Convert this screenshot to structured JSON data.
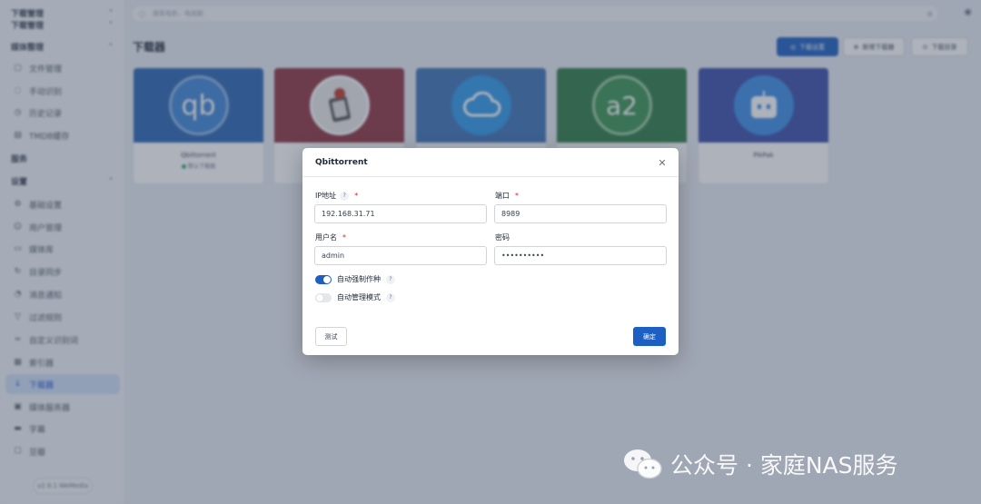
{
  "sidebar": {
    "items": [
      {
        "label": "下载管理",
        "type": "group",
        "icon": "",
        "chevron": "chevron-down-icon"
      },
      {
        "label": "下载管理",
        "type": "group",
        "icon": "",
        "chevron": "chevron-down-icon"
      },
      {
        "label": "媒体整理",
        "type": "group",
        "icon": "",
        "chevron": "chevron-up-icon"
      },
      {
        "label": "文件管理",
        "type": "sub",
        "icon": "folder-icon"
      },
      {
        "label": "手动识别",
        "type": "sub",
        "icon": "search-icon"
      },
      {
        "label": "历史记录",
        "type": "sub",
        "icon": "history-icon"
      },
      {
        "label": "TMDB缓存",
        "type": "sub",
        "icon": "database-icon"
      },
      {
        "label": "服务",
        "type": "group",
        "icon": ""
      },
      {
        "label": "设置",
        "type": "group",
        "icon": "",
        "chevron": "chevron-up-icon"
      },
      {
        "label": "基础设置",
        "type": "sub",
        "icon": "gear-icon"
      },
      {
        "label": "用户管理",
        "type": "sub",
        "icon": "user-icon"
      },
      {
        "label": "媒体库",
        "type": "sub",
        "icon": "library-icon"
      },
      {
        "label": "目录同步",
        "type": "sub",
        "icon": "sync-icon"
      },
      {
        "label": "消息通知",
        "type": "sub",
        "icon": "bell-icon"
      },
      {
        "label": "过滤规则",
        "type": "sub",
        "icon": "filter-icon"
      },
      {
        "label": "自定义识别词",
        "type": "sub",
        "icon": "words-icon"
      },
      {
        "label": "索引器",
        "type": "sub",
        "icon": "indexer-icon"
      },
      {
        "label": "下载器",
        "type": "sub",
        "icon": "download-icon",
        "active": true
      },
      {
        "label": "媒体服务器",
        "type": "sub",
        "icon": "server-icon"
      },
      {
        "label": "字幕",
        "type": "sub",
        "icon": "subtitle-icon"
      },
      {
        "label": "豆瓣",
        "type": "sub",
        "icon": "douban-icon"
      }
    ],
    "version": "v2.9.1 WeMedia"
  },
  "topbar": {
    "search_placeholder": "搜索电影、电视剧"
  },
  "page": {
    "title": "下载器",
    "buttons": [
      "下载设置",
      "新增下载器",
      "下载目录"
    ]
  },
  "cards": [
    {
      "name": "Qbittorrent",
      "status": "默认下载器",
      "logo": "qb",
      "color": "#2b67b4",
      "logo_icon": "qbittorrent-logo-icon"
    },
    {
      "name": "",
      "status": "",
      "logo": "",
      "color": "#8f3440",
      "logo_icon": "transmission-logo-icon"
    },
    {
      "name": "",
      "status": "",
      "logo": "",
      "color": "#3d73b6",
      "logo_icon": "cloud-icon"
    },
    {
      "name": "",
      "status": "",
      "logo": "a2",
      "color": "#2f7d45",
      "logo_icon": "aria2-logo-icon"
    },
    {
      "name": "PikPak",
      "status": "",
      "logo": "",
      "color": "#3b4ea9",
      "logo_icon": "robot-icon"
    }
  ],
  "modal": {
    "title": "Qbittorrent",
    "fields": {
      "ip": {
        "label": "IP地址",
        "value": "192.168.31.71",
        "required": true,
        "help": "?"
      },
      "port": {
        "label": "端口",
        "value": "8989",
        "required": true
      },
      "username": {
        "label": "用户名",
        "value": "admin",
        "required": true
      },
      "password": {
        "label": "密码",
        "value": "••••••••••"
      }
    },
    "switches": [
      {
        "label": "自动强制作种",
        "on": true,
        "help": "?"
      },
      {
        "label": "自动管理模式",
        "on": false,
        "help": "?"
      }
    ],
    "test_label": "测试",
    "ok_label": "确定",
    "required_mark": "*"
  },
  "watermark": {
    "text": "公众号 · 家庭NAS服务"
  }
}
